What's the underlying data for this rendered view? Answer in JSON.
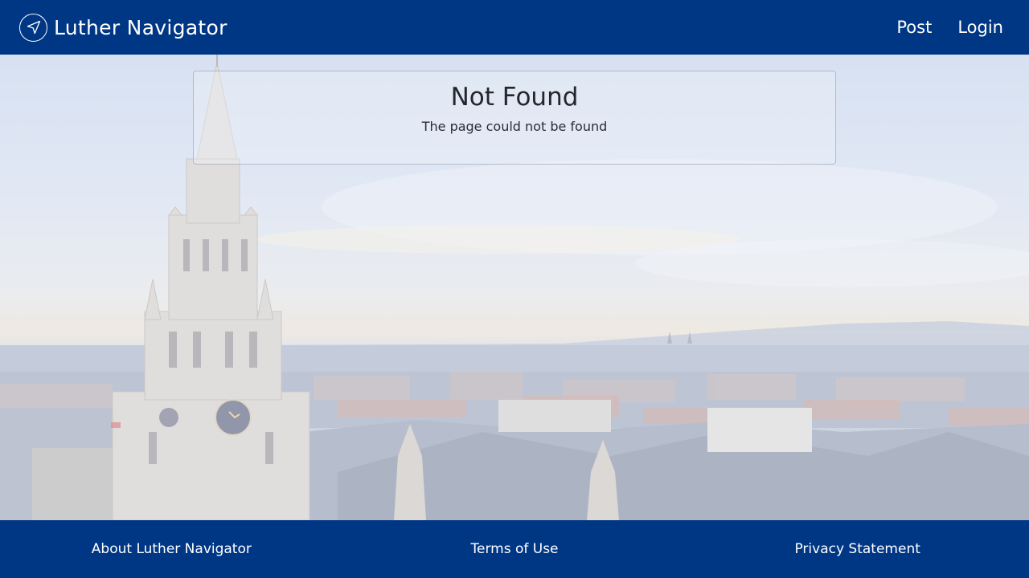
{
  "navbar": {
    "brand_name": "Luther Navigator",
    "brand_icon": "navigation-arrow-icon",
    "links": [
      {
        "label": "Post"
      },
      {
        "label": "Login"
      }
    ]
  },
  "main": {
    "title": "Not Found",
    "message": "The page could not be found"
  },
  "footer": {
    "links": [
      {
        "label": "About Luther Navigator"
      },
      {
        "label": "Terms of Use"
      },
      {
        "label": "Privacy Statement"
      }
    ]
  },
  "colors": {
    "brand_blue": "#003785",
    "text_dark": "#25262c",
    "white": "#ffffff"
  }
}
